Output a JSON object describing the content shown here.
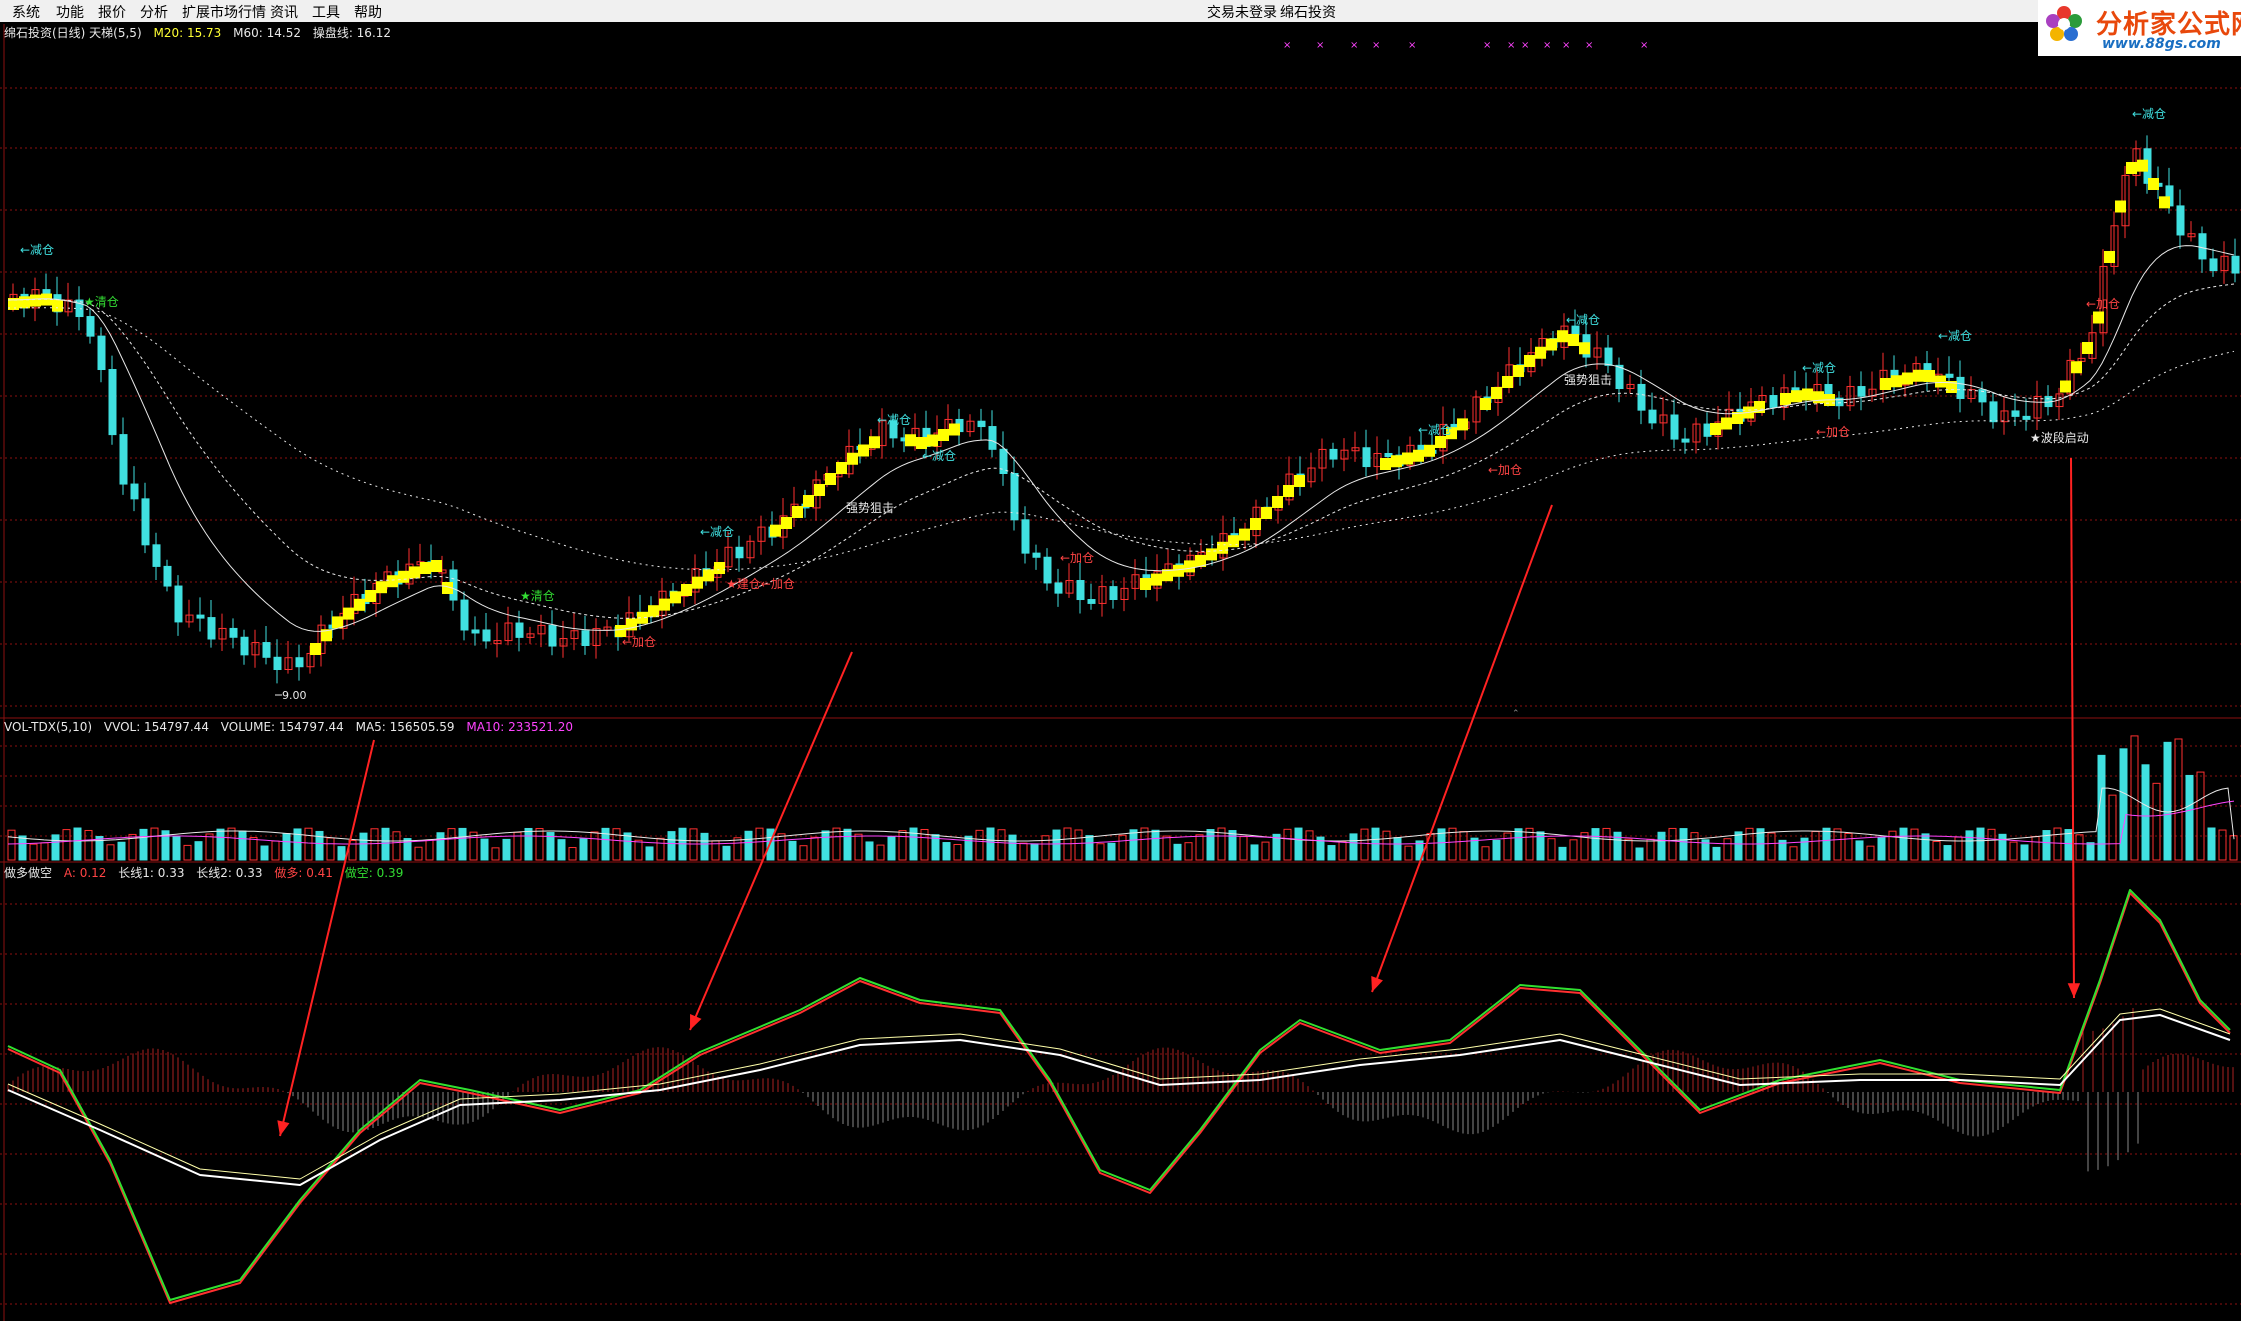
{
  "menu": {
    "items": [
      "系统",
      "功能",
      "报价",
      "分析",
      "扩展市场行情",
      "资讯",
      "工具",
      "帮助"
    ],
    "login_status": "交易未登录",
    "app_name": "绵石投资"
  },
  "logo": {
    "text": "分析家公式网",
    "url": "www.88gs.com"
  },
  "main_panel": {
    "title": "绵石投资(日线) 天梯(5,5)",
    "m20": "M20: 15.73",
    "m60": "M60: 14.52",
    "trade_line": "操盘线: 16.12",
    "low_label": "9.00",
    "annotations": [
      {
        "text": "←减仓",
        "color": "#40e0e0"
      },
      {
        "text": "★清仓",
        "color": "#33dd33"
      },
      {
        "text": "★清仓",
        "color": "#33dd33"
      },
      {
        "text": "←加仓",
        "color": "#ff4444"
      },
      {
        "text": "←减仓",
        "color": "#40e0e0"
      },
      {
        "text": "★建仓←加仓",
        "color": "#ff4444"
      },
      {
        "text": "强势狙击",
        "color": "#e8e8e8"
      },
      {
        "text": "←减仓",
        "color": "#40e0e0"
      },
      {
        "text": "←加仓",
        "color": "#ff4444"
      },
      {
        "text": "←减仓",
        "color": "#40e0e0"
      },
      {
        "text": "←减仓",
        "color": "#40e0e0"
      },
      {
        "text": "←加仓",
        "color": "#ff4444"
      },
      {
        "text": "强势狙击",
        "color": "#e8e8e8"
      },
      {
        "text": "←减仓",
        "color": "#40e0e0"
      },
      {
        "text": "←减仓",
        "color": "#40e0e0"
      },
      {
        "text": "←加仓",
        "color": "#ff4444"
      },
      {
        "text": "←减仓",
        "color": "#40e0e0"
      },
      {
        "text": "←减仓",
        "color": "#40e0e0"
      },
      {
        "text": "←加仓",
        "color": "#ff4444"
      },
      {
        "text": "★波段启动",
        "color": "#e8e8e8"
      }
    ]
  },
  "volume_panel": {
    "title": "VOL-TDX(5,10)",
    "vvol": "VVOL: 154797.44",
    "volume": "VOLUME: 154797.44",
    "ma5": "MA5: 156505.59",
    "ma10": "MA10: 233521.20"
  },
  "indicator_panel": {
    "title": "做多做空",
    "a": "A: 0.12",
    "long1": "长线1: 0.33",
    "long2": "长线2: 0.33",
    "bull": "做多: 0.41",
    "bear": "做空: 0.39"
  },
  "colors": {
    "up": "#ff3030",
    "down": "#40e0e0",
    "ladder": "#ffff00",
    "grid": "#8b1010",
    "arrow": "#ff2222",
    "bull": "#ff3030",
    "bear": "#30e030"
  }
}
